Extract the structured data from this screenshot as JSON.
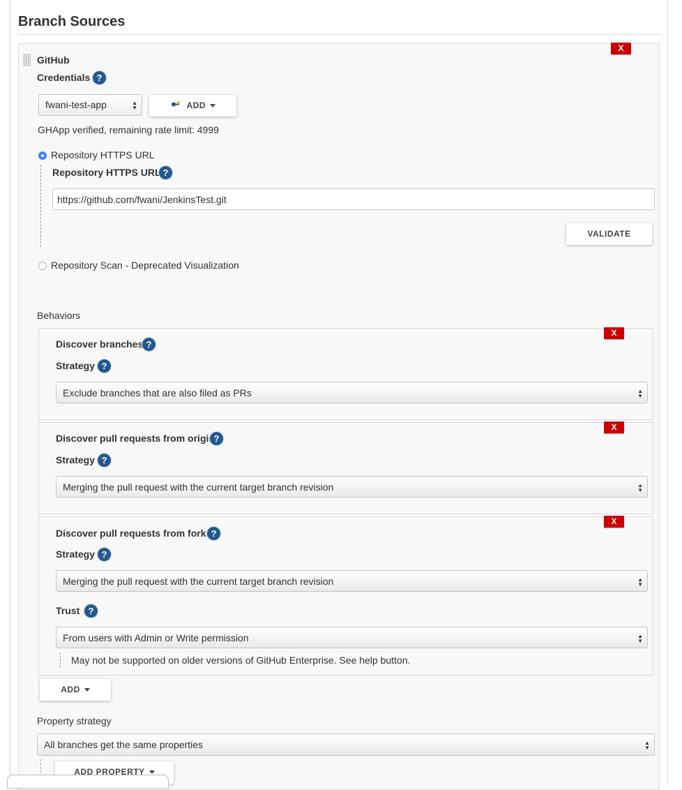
{
  "section": {
    "title": "Branch Sources"
  },
  "github": {
    "title": "GitHub",
    "delete_label": "X",
    "credentials": {
      "label": "Credentials",
      "help": "?",
      "selected": "fwani-test-app",
      "add_label": "ADD",
      "status": "GHApp verified, remaining rate limit: 4999"
    },
    "repo_options": {
      "https_option": "Repository HTTPS URL",
      "https_field_label": "Repository HTTPS URL",
      "https_value": "https://github.com/fwani/JenkinsTest.git",
      "validate_label": "VALIDATE",
      "scan_option": "Repository Scan - Deprecated Visualization"
    },
    "behaviors": {
      "label": "Behaviors",
      "items": [
        {
          "title": "Discover branches",
          "strategy_label": "Strategy",
          "strategy_value": "Exclude branches that are also filed as PRs",
          "delete_label": "X"
        },
        {
          "title": "Discover pull requests from origin",
          "strategy_label": "Strategy",
          "strategy_value": "Merging the pull request with the current target branch revision",
          "delete_label": "X"
        },
        {
          "title": "Discover pull requests from forks",
          "strategy_label": "Strategy",
          "strategy_value": "Merging the pull request with the current target branch revision",
          "trust_label": "Trust",
          "trust_value": "From users with Admin or Write permission",
          "note": "May not be supported on older versions of GitHub Enterprise. See help button.",
          "delete_label": "X"
        }
      ],
      "add_label": "ADD"
    },
    "property_strategy": {
      "label": "Property strategy",
      "value": "All branches get the same properties",
      "add_property_label": "ADD PROPERTY"
    }
  },
  "icons": {
    "help": "question-mark-circle",
    "credential_key": "key-icon",
    "select": "updown-arrows"
  },
  "colors": {
    "delete": "#cc0000",
    "help": "#24588f",
    "radio": "#3b82f6"
  }
}
